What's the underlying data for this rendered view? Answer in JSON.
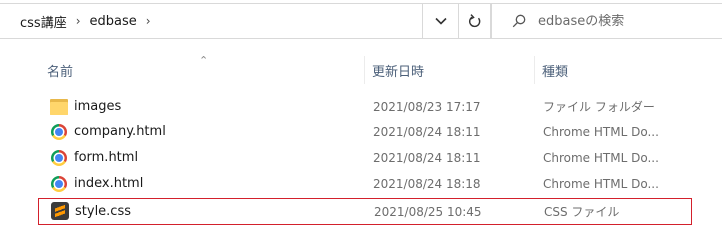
{
  "address_bar": {
    "breadcrumbs": [
      {
        "label": "css講座"
      },
      {
        "label": "edbase"
      }
    ],
    "search_placeholder": "edbaseの検索"
  },
  "columns": {
    "name": "名前",
    "date_modified": "更新日時",
    "type": "種類"
  },
  "files": [
    {
      "name": "images",
      "date": "2021/08/23 17:17",
      "type": "ファイル フォルダー",
      "icon": "folder-icon"
    },
    {
      "name": "company.html",
      "date": "2021/08/24 18:11",
      "type": "Chrome HTML Do...",
      "icon": "chrome-icon"
    },
    {
      "name": "form.html",
      "date": "2021/08/24 18:11",
      "type": "Chrome HTML Do...",
      "icon": "chrome-icon"
    },
    {
      "name": "index.html",
      "date": "2021/08/24 18:18",
      "type": "Chrome HTML Do...",
      "icon": "chrome-icon"
    },
    {
      "name": "style.css",
      "date": "2021/08/25 10:45",
      "type": "CSS ファイル",
      "icon": "sublime-text-icon",
      "highlighted": true
    }
  ],
  "colors": {
    "highlight_border": "#d3202c",
    "header_text": "#4c607a"
  }
}
